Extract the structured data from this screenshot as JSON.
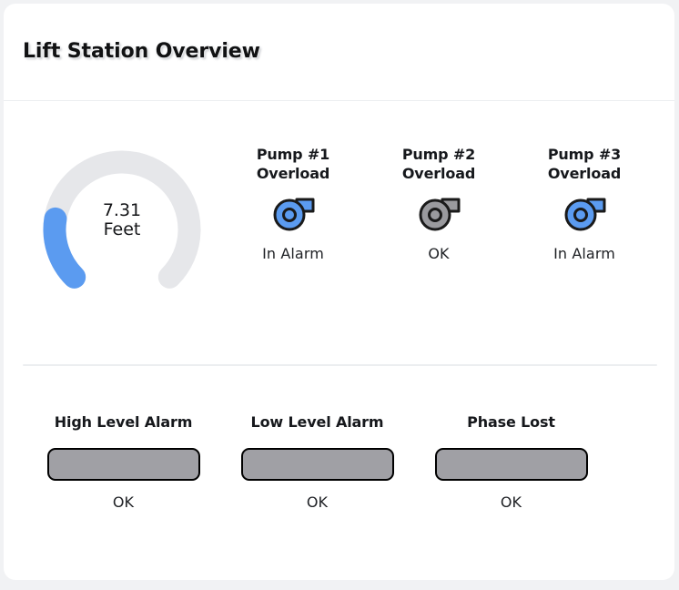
{
  "header": {
    "title": "Lift Station Overview"
  },
  "gauge": {
    "name": "level-gauge",
    "value": "7.31",
    "unit": "Feet",
    "numeric_value": 7.31,
    "min": 0,
    "max": 36,
    "percent": 20,
    "sweep_degrees": 270,
    "start_angle_degrees": 135,
    "fill_color": "#5b9bf0",
    "track_color": "#e6e7ea"
  },
  "pumps": [
    {
      "title_line1": "Pump #1",
      "title_line2": "Overload",
      "status": "In Alarm",
      "state": "alarm",
      "icon": "pump-icon",
      "color": "#5b9bf0"
    },
    {
      "title_line1": "Pump #2",
      "title_line2": "Overload",
      "status": "OK",
      "state": "ok",
      "icon": "pump-icon",
      "color": "#9a9a9e"
    },
    {
      "title_line1": "Pump #3",
      "title_line2": "Overload",
      "status": "In Alarm",
      "state": "alarm",
      "icon": "pump-icon",
      "color": "#5b9bf0"
    }
  ],
  "alarms": [
    {
      "title": "High Level Alarm",
      "status": "OK",
      "state": "ok",
      "color": "#a0a0a5"
    },
    {
      "title": "Low Level Alarm",
      "status": "OK",
      "state": "ok",
      "color": "#a0a0a5"
    },
    {
      "title": "Phase Lost",
      "status": "OK",
      "state": "ok",
      "color": "#a0a0a5"
    }
  ],
  "colors": {
    "page_background": "#f1f2f4",
    "card_background": "#ffffff",
    "divider": "#eceef0",
    "accent_blue": "#5b9bf0",
    "neutral_gray": "#9a9a9e",
    "text": "#16181c"
  }
}
